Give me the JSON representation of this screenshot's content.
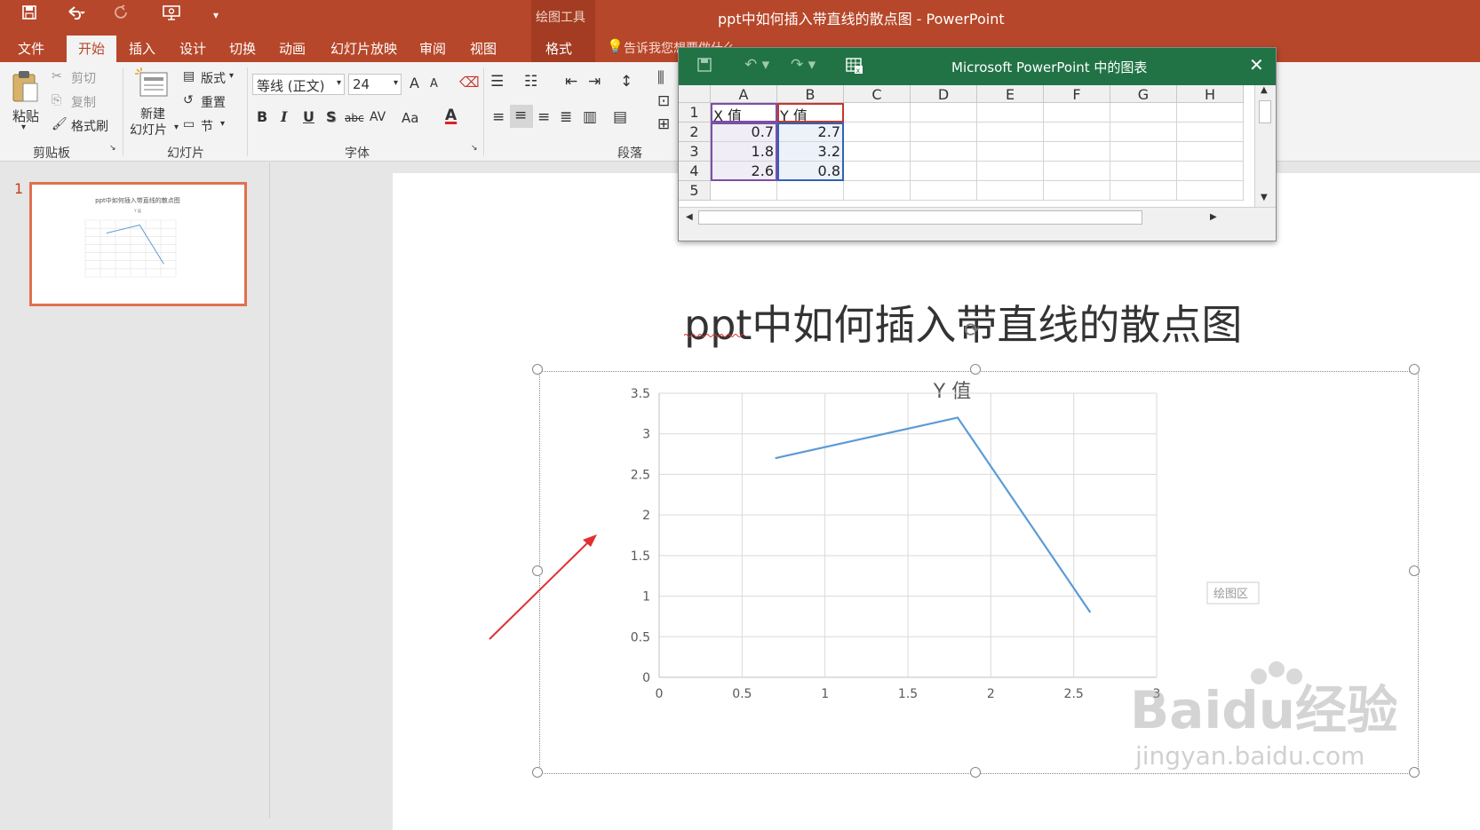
{
  "titlebar": {
    "doc_title": "ppt中如何插入带直线的散点图 - PowerPoint",
    "context_tool": "绘图工具",
    "qa_icons": [
      "save-icon",
      "undo-icon",
      "redo-icon",
      "presentation-icon",
      "customize-icon"
    ]
  },
  "tabs": [
    {
      "label": "文件"
    },
    {
      "label": "开始",
      "active": true
    },
    {
      "label": "插入"
    },
    {
      "label": "设计"
    },
    {
      "label": "切换"
    },
    {
      "label": "动画"
    },
    {
      "label": "幻灯片放映"
    },
    {
      "label": "审阅"
    },
    {
      "label": "视图"
    },
    {
      "label": "格式"
    }
  ],
  "tell_me": "告诉我您想要做什么",
  "ribbon": {
    "clipboard": {
      "paste": "粘贴",
      "cut": "剪切",
      "copy": "复制",
      "format_painter": "格式刷",
      "label": "剪贴板"
    },
    "slides": {
      "new_slide_1": "新建",
      "new_slide_2": "幻灯片",
      "layout": "版式",
      "reset": "重置",
      "section": "节",
      "label": "幻灯片"
    },
    "font": {
      "name": "等线 (正文)",
      "size": "24",
      "grow": "A",
      "shrink": "A",
      "bold": "B",
      "italic": "I",
      "underline": "U",
      "shadow": "S",
      "strike": "abc",
      "spacing": "AV",
      "case": "Aa",
      "color": "A",
      "label": "字体"
    },
    "paragraph": {
      "label": "段落"
    }
  },
  "slide_number": "1",
  "slide": {
    "title": "ppt中如何插入带直线的散点图"
  },
  "chart_data": {
    "type": "scatter",
    "title": "Y 值",
    "x": [
      0.7,
      1.8,
      2.6
    ],
    "y": [
      2.7,
      3.2,
      0.8
    ],
    "xlim": [
      0,
      3
    ],
    "ylim": [
      0,
      3.5
    ],
    "x_ticks": [
      "0",
      "0.5",
      "1",
      "1.5",
      "2",
      "2.5",
      "3"
    ],
    "y_ticks": [
      "0",
      "0.5",
      "1",
      "1.5",
      "2",
      "2.5",
      "3",
      "3.5"
    ],
    "grid": true,
    "line_color": "#5b9bd5",
    "tooltip": "绘图区"
  },
  "excel": {
    "title": "Microsoft PowerPoint 中的图表",
    "columns": [
      "A",
      "B",
      "C",
      "D",
      "E",
      "F",
      "G",
      "H"
    ],
    "rows": [
      "1",
      "2",
      "3",
      "4",
      "5"
    ],
    "cells": [
      [
        "X 值",
        "Y 值"
      ],
      [
        "0.7",
        "2.7"
      ],
      [
        "1.8",
        "3.2"
      ],
      [
        "2.6",
        "0.8"
      ],
      [
        "",
        ""
      ]
    ]
  },
  "watermark": {
    "brand": "Baidu经验",
    "url": "jingyan.baidu.com"
  },
  "colors": {
    "ppt_accent": "#b7472a",
    "excel_accent": "#217346",
    "arrow": "#e03030"
  }
}
